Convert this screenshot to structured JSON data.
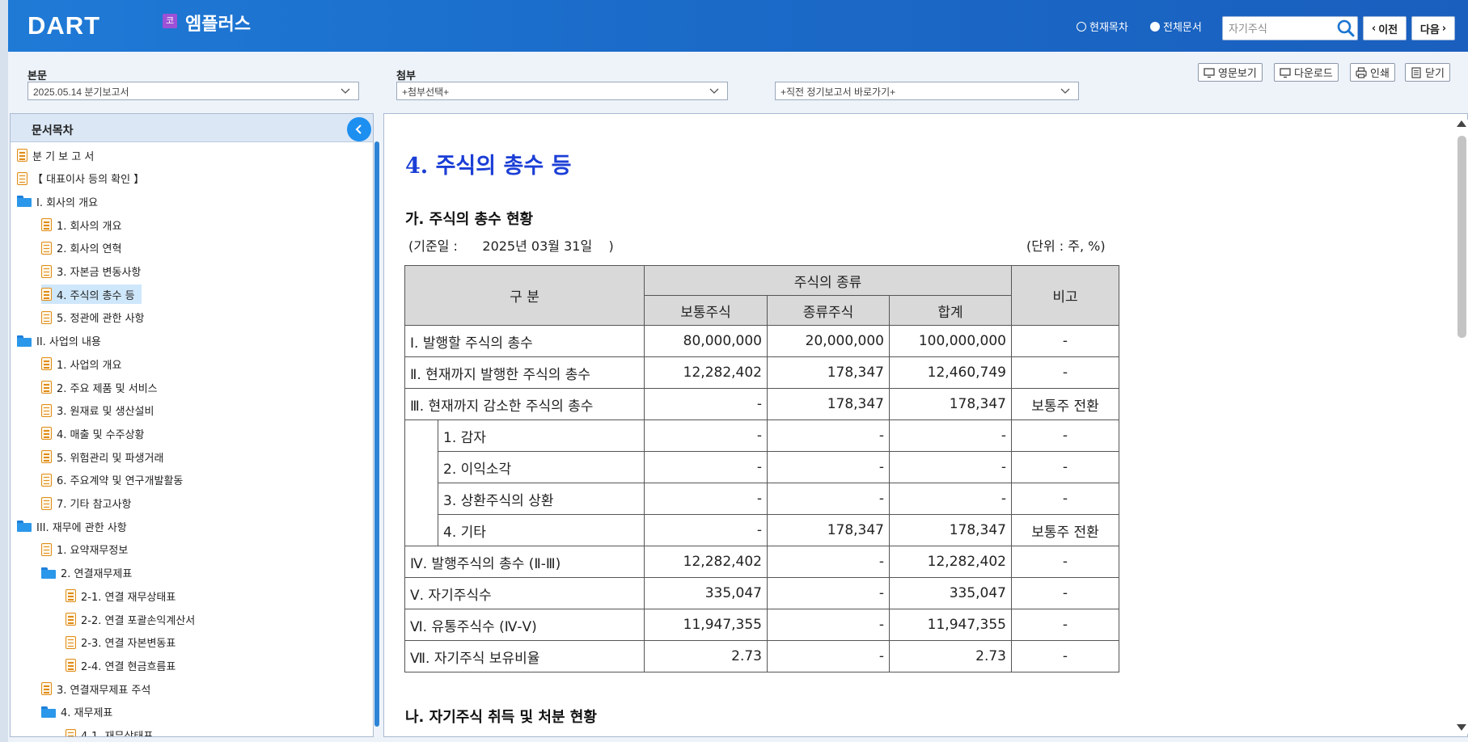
{
  "header": {
    "logo": "DART",
    "corp_badge": "코",
    "corp_name": "엠플러스",
    "radio_current": "현재목차",
    "radio_all": "전체문서",
    "search_placeholder": "자기주식",
    "prev_label": "이전",
    "next_label": "다음"
  },
  "selectors": {
    "body_label": "본문",
    "body_value": "2025.05.14  분기보고서",
    "attach_label": "첨부",
    "attach_value": "+첨부선택+",
    "prior_value": "+직전 정기보고서 바로가기+"
  },
  "tools": {
    "english": "영문보기",
    "download": "다운로드",
    "print": "인쇄",
    "close": "닫기"
  },
  "sidebar": {
    "title": "문서목차",
    "items": [
      {
        "label": "분 기 보 고 서",
        "icon": "doc-icon"
      },
      {
        "label": "【 대표이사 등의 확인 】",
        "icon": "doc-icon"
      },
      {
        "label": "I. 회사의 개요",
        "icon": "folder-icon"
      },
      {
        "label": "1. 회사의 개요",
        "icon": "doc-icon"
      },
      {
        "label": "2. 회사의 연혁",
        "icon": "doc-icon"
      },
      {
        "label": "3. 자본금 변동사항",
        "icon": "doc-icon"
      },
      {
        "label": "4. 주식의 총수 등",
        "icon": "doc-icon",
        "selected": true
      },
      {
        "label": "5. 정관에 관한 사항",
        "icon": "doc-icon"
      },
      {
        "label": "II. 사업의 내용",
        "icon": "folder-icon"
      },
      {
        "label": "1. 사업의 개요",
        "icon": "doc-icon"
      },
      {
        "label": "2. 주요 제품 및 서비스",
        "icon": "doc-icon"
      },
      {
        "label": "3. 원재료 및 생산설비",
        "icon": "doc-icon"
      },
      {
        "label": "4. 매출 및 수주상황",
        "icon": "doc-icon"
      },
      {
        "label": "5. 위험관리 및 파생거래",
        "icon": "doc-icon"
      },
      {
        "label": "6. 주요계약 및 연구개발활동",
        "icon": "doc-icon"
      },
      {
        "label": "7. 기타 참고사항",
        "icon": "doc-icon"
      },
      {
        "label": "III. 재무에 관한 사항",
        "icon": "folder-icon"
      },
      {
        "label": "1. 요약재무정보",
        "icon": "doc-icon"
      },
      {
        "label": "2. 연결재무제표",
        "icon": "folder-icon"
      },
      {
        "label": "2-1. 연결 재무상태표",
        "icon": "doc-icon"
      },
      {
        "label": "2-2. 연결 포괄손익계산서",
        "icon": "doc-icon"
      },
      {
        "label": "2-3. 연결 자본변동표",
        "icon": "doc-icon"
      },
      {
        "label": "2-4. 연결 현금흐름표",
        "icon": "doc-icon"
      },
      {
        "label": "3. 연결재무제표 주석",
        "icon": "doc-icon"
      },
      {
        "label": "4. 재무제표",
        "icon": "folder-icon"
      },
      {
        "label": "4-1. 재무상태표",
        "icon": "doc-icon"
      }
    ]
  },
  "content": {
    "title": "4. 주식의 총수 등",
    "section_a": "가. 주식의 총수 현황",
    "base_date": "(기준일 :      2025년 03월 31일    )",
    "unit": "(단위 : 주, %)",
    "section_b": "나. 자기주식 취득 및 처분 현황",
    "table": {
      "h_category": "구 분",
      "h_type": "주식의 종류",
      "h_common": "보통주식",
      "h_preferred": "종류주식",
      "h_total": "합계",
      "h_note": "비고",
      "rows": [
        {
          "label": "Ⅰ. 발행할 주식의 총수",
          "common": "80,000,000",
          "preferred": "20,000,000",
          "total": "100,000,000",
          "note": "-"
        },
        {
          "label": "Ⅱ. 현재까지 발행한 주식의 총수",
          "common": "12,282,402",
          "preferred": "178,347",
          "total": "12,460,749",
          "note": "-"
        },
        {
          "label": "Ⅲ. 현재까지 감소한 주식의 총수",
          "common": "-",
          "preferred": "178,347",
          "total": "178,347",
          "note": "보통주 전환"
        },
        {
          "label": "1. 감자",
          "common": "-",
          "preferred": "-",
          "total": "-",
          "note": "-"
        },
        {
          "label": "2. 이익소각",
          "common": "-",
          "preferred": "-",
          "total": "-",
          "note": "-"
        },
        {
          "label": "3. 상환주식의 상환",
          "common": "-",
          "preferred": "-",
          "total": "-",
          "note": "-"
        },
        {
          "label": "4. 기타",
          "common": "-",
          "preferred": "178,347",
          "total": "178,347",
          "note": "보통주 전환"
        },
        {
          "label": "Ⅳ. 발행주식의 총수 (Ⅱ-Ⅲ)",
          "common": "12,282,402",
          "preferred": "-",
          "total": "12,282,402",
          "note": "-"
        },
        {
          "label": "Ⅴ. 자기주식수",
          "common": "335,047",
          "preferred": "-",
          "total": "335,047",
          "note": "-"
        },
        {
          "label": "Ⅵ. 유통주식수 (Ⅳ-Ⅴ)",
          "common": "11,947,355",
          "preferred": "-",
          "total": "11,947,355",
          "note": "-"
        },
        {
          "label": "Ⅶ. 자기주식 보유비율",
          "common": "2.73",
          "preferred": "-",
          "total": "2.73",
          "note": "-"
        }
      ]
    }
  }
}
